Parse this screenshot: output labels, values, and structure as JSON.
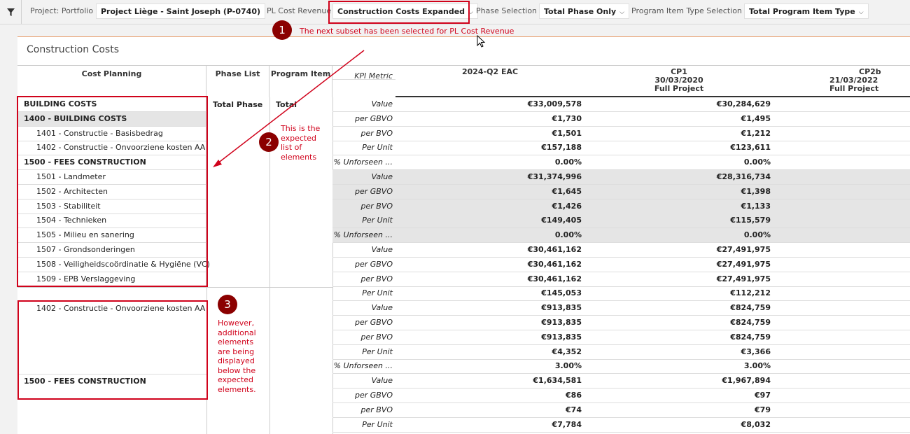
{
  "filters": {
    "project_label": "Project: Portfolio",
    "project_value": "Project Liège - Saint Joseph (P-0740)",
    "pl_label": "PL Cost Revenue",
    "pl_value": "Construction Costs Expanded",
    "phase_label": "Phase Selection",
    "phase_value": "Total Phase Only",
    "program_label": "Program Item Type Selection",
    "program_value": "Total Program Item Type"
  },
  "annotations": {
    "m1": "1",
    "m2": "2",
    "m3": "3",
    "note1": "The next subset has been selected for PL Cost Revenue",
    "note2": [
      "This is the",
      "expected",
      "list of",
      "elements"
    ],
    "note3": [
      "However,",
      "additional",
      "elements",
      "are being",
      "displayed",
      "below the",
      "expected",
      "elements."
    ]
  },
  "panel": {
    "title": "Construction Costs"
  },
  "headers": {
    "cost_planning": "Cost Planning",
    "phase_list": "Phase List",
    "program_item": "Program Item",
    "kpi_metric": "KPI Metric",
    "col1": [
      "2024-Q2 EAC"
    ],
    "col2": [
      "CP1",
      "30/03/2020",
      "Full Project"
    ],
    "col3": [
      "CP2b",
      "21/03/2022",
      "Full Project"
    ]
  },
  "cost_items": [
    {
      "label": "BUILDING COSTS",
      "bold": true
    },
    {
      "label": "1400 - BUILDING COSTS",
      "bold": true,
      "gray": true
    },
    {
      "label": "1401 - Constructie - Basisbedrag"
    },
    {
      "label": "1402 - Constructie - Onvoorziene kosten AA"
    },
    {
      "label": "1500 - FEES CONSTRUCTION",
      "bold": true
    },
    {
      "label": "1501 - Landmeter"
    },
    {
      "label": "1502 - Architecten"
    },
    {
      "label": "1503 - Stabiliteit"
    },
    {
      "label": "1504 - Technieken"
    },
    {
      "label": "1505 - Milieu en sanering"
    },
    {
      "label": "1507 - Grondsonderingen"
    },
    {
      "label": "1508 - Veiligheidscoördinatie & Hygiëne (VC)"
    },
    {
      "label": "1509 - EPB Verslaggeving"
    }
  ],
  "extra_items": {
    "item1": "1402 - Constructie - Onvoorziene kosten AA",
    "item2": "1500 - FEES CONSTRUCTION"
  },
  "phase_value": "Total Phase",
  "program_value": "Total",
  "rows": [
    {
      "kpi": "Value",
      "c1": "€33,009,578",
      "c2": "€30,284,629"
    },
    {
      "kpi": "per GBVO",
      "c1": "€1,730",
      "c2": "€1,495"
    },
    {
      "kpi": "per BVO",
      "c1": "€1,501",
      "c2": "€1,212"
    },
    {
      "kpi": "Per Unit",
      "c1": "€157,188",
      "c2": "€123,611"
    },
    {
      "kpi": "% Unforseen ...",
      "c1": "0.00%",
      "c2": "0.00%"
    },
    {
      "kpi": "Value",
      "c1": "€31,374,996",
      "c2": "€28,316,734",
      "gray": true
    },
    {
      "kpi": "per GBVO",
      "c1": "€1,645",
      "c2": "€1,398",
      "gray": true
    },
    {
      "kpi": "per BVO",
      "c1": "€1,426",
      "c2": "€1,133",
      "gray": true
    },
    {
      "kpi": "Per Unit",
      "c1": "€149,405",
      "c2": "€115,579",
      "gray": true
    },
    {
      "kpi": "% Unforseen ...",
      "c1": "0.00%",
      "c2": "0.00%",
      "gray": true
    },
    {
      "kpi": "Value",
      "c1": "€30,461,162",
      "c2": "€27,491,975"
    },
    {
      "kpi": "per GBVO",
      "c1": "€30,461,162",
      "c2": "€27,491,975"
    },
    {
      "kpi": "per BVO",
      "c1": "€30,461,162",
      "c2": "€27,491,975"
    },
    {
      "kpi": "Per Unit",
      "c1": "€145,053",
      "c2": "€112,212"
    },
    {
      "kpi": "Value",
      "c1": "€913,835",
      "c2": "€824,759"
    },
    {
      "kpi": "per GBVO",
      "c1": "€913,835",
      "c2": "€824,759"
    },
    {
      "kpi": "per BVO",
      "c1": "€913,835",
      "c2": "€824,759"
    },
    {
      "kpi": "Per Unit",
      "c1": "€4,352",
      "c2": "€3,366"
    },
    {
      "kpi": "% Unforseen ...",
      "c1": "3.00%",
      "c2": "3.00%"
    },
    {
      "kpi": "Value",
      "c1": "€1,634,581",
      "c2": "€1,967,894"
    },
    {
      "kpi": "per GBVO",
      "c1": "€86",
      "c2": "€97"
    },
    {
      "kpi": "per BVO",
      "c1": "€74",
      "c2": "€79"
    },
    {
      "kpi": "Per Unit",
      "c1": "€7,784",
      "c2": "€8,032"
    }
  ],
  "colors": {
    "annotation_red": "#d0021b",
    "marker": "#8b0000"
  }
}
